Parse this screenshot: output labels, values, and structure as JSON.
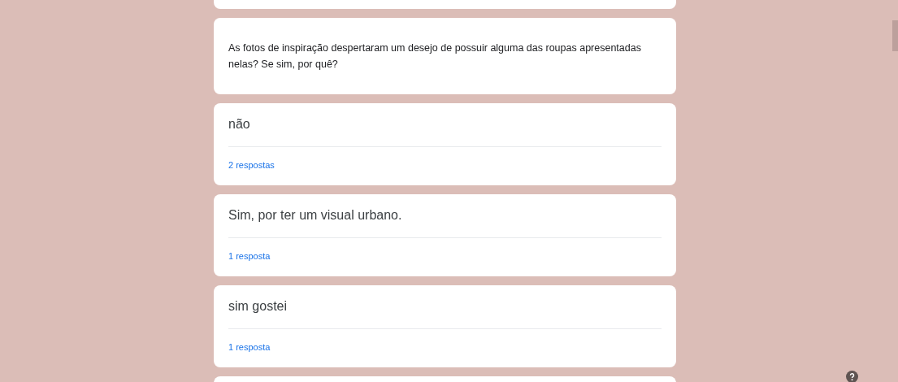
{
  "question": {
    "text": "As fotos de inspiração despertaram um desejo de possuir alguma das roupas apresentadas nelas? Se sim, por quê?"
  },
  "answers": [
    {
      "text": "não",
      "count": "2 respostas"
    },
    {
      "text": "Sim, por ter um visual urbano.",
      "count": "1 resposta"
    },
    {
      "text": "sim gostei",
      "count": "1 resposta"
    }
  ]
}
